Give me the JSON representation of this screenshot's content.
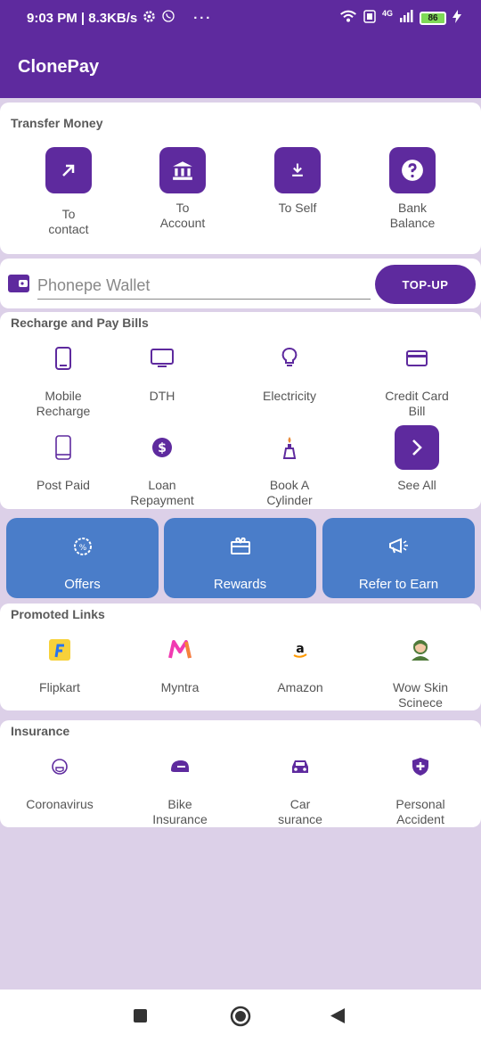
{
  "status_bar": {
    "time_speed": "9:03 PM | 8.3KB/s",
    "more": "···",
    "network": "4G",
    "battery": "86"
  },
  "app_bar": {
    "title": "ClonePay"
  },
  "transfer": {
    "title": "Transfer Money",
    "items": [
      {
        "label": "To\ncontact",
        "icon": "arrow-up-right-icon"
      },
      {
        "label": "To\nAccount",
        "icon": "bank-icon"
      },
      {
        "label": "To Self",
        "icon": "download-icon"
      },
      {
        "label": "Bank\nBalance",
        "icon": "question-icon"
      }
    ]
  },
  "wallet": {
    "placeholder": "Phonepe Wallet",
    "topup_label": "TOP-UP"
  },
  "recharge": {
    "title": "Recharge and Pay Bills",
    "items": [
      {
        "label": "Mobile\nRecharge",
        "icon": "mobile-icon"
      },
      {
        "label": "DTH",
        "icon": "tv-icon"
      },
      {
        "label": "Electricity",
        "icon": "bulb-icon"
      },
      {
        "label": "Credit Card\nBill",
        "icon": "credit-card-icon"
      },
      {
        "label": "Post Paid",
        "icon": "phone-outline-icon"
      },
      {
        "label": "Loan\nRepayment",
        "icon": "dollar-icon"
      },
      {
        "label": "Book A\nCylinder",
        "icon": "cylinder-icon"
      },
      {
        "label": "See All",
        "icon": "chevron-right-icon"
      }
    ]
  },
  "quick_actions": [
    {
      "label": "Offers",
      "icon": "offer-badge-icon"
    },
    {
      "label": "Rewards",
      "icon": "gift-icon"
    },
    {
      "label": "Refer to Earn",
      "icon": "megaphone-icon"
    }
  ],
  "promoted": {
    "title": "Promoted Links",
    "items": [
      {
        "label": "Flipkart",
        "icon": "flipkart-logo-icon"
      },
      {
        "label": "Myntra",
        "icon": "myntra-logo-icon"
      },
      {
        "label": "Amazon",
        "icon": "amazon-logo-icon"
      },
      {
        "label": "Wow Skin\nScinece",
        "icon": "wow-skin-logo-icon"
      }
    ]
  },
  "insurance": {
    "title": "Insurance",
    "items": [
      {
        "label": "Coronavirus",
        "icon": "mask-icon"
      },
      {
        "label": "Bike\nInsurance",
        "icon": "helmet-icon"
      },
      {
        "label": "Car\nsurance",
        "icon": "car-icon"
      },
      {
        "label": "Personal\nAccident",
        "icon": "shield-plus-icon"
      }
    ]
  },
  "colors": {
    "primary": "#5e2a9e",
    "accent_blue": "#4a7dc9",
    "background": "#dcd0e8"
  }
}
